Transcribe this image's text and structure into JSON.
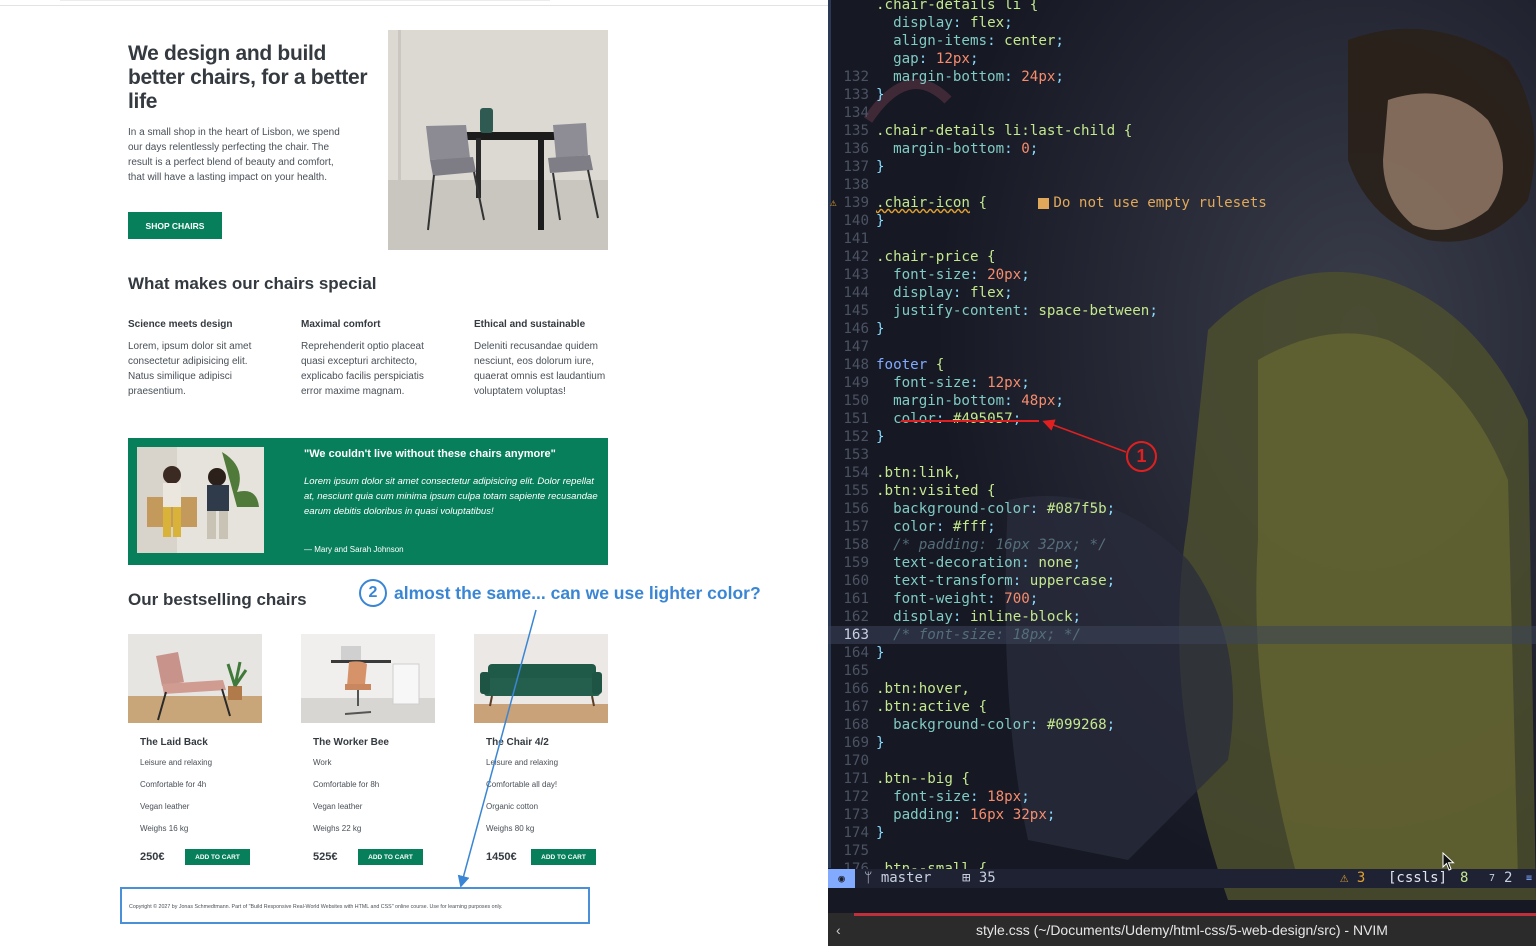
{
  "page": {
    "hero": {
      "title": "We design and build better chairs, for a better life",
      "text": "In a small shop in the heart of Lisbon, we spend our days relentlessly perfecting the chair. The result is a perfect blend of beauty and comfort, that will have a lasting impact on your health.",
      "button": "SHOP CHAIRS"
    },
    "features": {
      "heading": "What makes our chairs special",
      "items": [
        {
          "title": "Science meets design",
          "text": "Lorem, ipsum dolor sit amet consectetur adipisicing elit. Natus similique adipisci praesentium."
        },
        {
          "title": "Maximal comfort",
          "text": "Reprehenderit optio placeat quasi excepturi architecto, explicabo facilis perspiciatis error maxime magnam."
        },
        {
          "title": "Ethical and sustainable",
          "text": "Deleniti recusandae quidem nesciunt, eos dolorum iure, quaerat omnis est laudantium voluptatem voluptas!"
        }
      ]
    },
    "testimonial": {
      "quote": "\"We couldn't live without these chairs anymore\"",
      "text": "Lorem ipsum dolor sit amet consectetur adipisicing elit. Dolor repellat at, nesciunt quia cum minima ipsum culpa totam sapiente recusandae earum debitis doloribus in quasi voluptatibus!",
      "author": "— Mary and Sarah Johnson"
    },
    "products": {
      "heading": "Our bestselling chairs",
      "items": [
        {
          "name": "The Laid Back",
          "details": [
            "Leisure and relaxing",
            "Comfortable for 4h",
            "Vegan leather",
            "Weighs 16 kg"
          ],
          "price": "250€",
          "button": "ADD TO CART"
        },
        {
          "name": "The Worker Bee",
          "details": [
            "Work",
            "Comfortable for 8h",
            "Vegan leather",
            "Weighs 22 kg"
          ],
          "price": "525€",
          "button": "ADD TO CART"
        },
        {
          "name": "The Chair 4/2",
          "details": [
            "Leisure and relaxing",
            "Comfortable all day!",
            "Organic cotton",
            "Weighs 80 kg"
          ],
          "price": "1450€",
          "button": "ADD TO CART"
        }
      ]
    },
    "footer": "Copyright © 2027 by Jonas Schmedtmann. Part of \"Build Responsive Real-World Websites with HTML and CSS\" online course. Use for learning purposes only."
  },
  "annotations": {
    "one": "1",
    "two": "2",
    "two_text": "almost the same... can we use lighter color?",
    "red": "#e02020",
    "blue": "#3a86d4"
  },
  "editor": {
    "lines": [
      {
        "n": "",
        "html": "<span class='sel'>.chair-details li {</span>"
      },
      {
        "n": "",
        "html": "  <span class='prop'>display</span><span class='punc'>:</span> <span class='kw'>flex</span><span class='punc'>;</span>"
      },
      {
        "n": "",
        "html": "  <span class='prop'>align-items</span><span class='punc'>:</span> <span class='kw'>center</span><span class='punc'>;</span>"
      },
      {
        "n": "",
        "html": "  <span class='prop'>gap</span><span class='punc'>:</span> <span class='num'>12px</span><span class='punc'>;</span>"
      },
      {
        "n": "132",
        "html": "  <span class='prop'>margin-bottom</span><span class='punc'>:</span> <span class='num'>24px</span><span class='punc'>;</span>"
      },
      {
        "n": "133",
        "html": "<span class='punc'>}</span>"
      },
      {
        "n": "134",
        "html": ""
      },
      {
        "n": "135",
        "html": "<span class='sel'>.chair-details li:last-child {</span>"
      },
      {
        "n": "136",
        "html": "  <span class='prop'>margin-bottom</span><span class='punc'>:</span> <span class='num'>0</span><span class='punc'>;</span>"
      },
      {
        "n": "137",
        "html": "<span class='punc'>}</span>"
      },
      {
        "n": "138",
        "html": ""
      },
      {
        "n": "139",
        "warn": true,
        "html": "<span class='sel' style='text-decoration: underline wavy #e0a030;'>.chair-icon</span> <span class='sel'>{</span>      <span class='diag'><span class='diag-box'></span>Do not use empty rulesets</span>"
      },
      {
        "n": "140",
        "html": "<span class='punc'>}</span>"
      },
      {
        "n": "141",
        "html": ""
      },
      {
        "n": "142",
        "html": "<span class='sel'>.chair-price {</span>"
      },
      {
        "n": "143",
        "html": "  <span class='prop'>font-size</span><span class='punc'>:</span> <span class='num'>20px</span><span class='punc'>;</span>"
      },
      {
        "n": "144",
        "html": "  <span class='prop'>display</span><span class='punc'>:</span> <span class='kw'>flex</span><span class='punc'>;</span>"
      },
      {
        "n": "145",
        "html": "  <span class='prop'>justify-content</span><span class='punc'>:</span> <span class='kw'>space-between</span><span class='punc'>;</span>"
      },
      {
        "n": "146",
        "html": "<span class='punc'>}</span>"
      },
      {
        "n": "147",
        "html": ""
      },
      {
        "n": "148",
        "html": "<span style='color:#82aaff'>footer</span> <span class='sel'>{</span>"
      },
      {
        "n": "149",
        "html": "  <span class='prop'>font-size</span><span class='punc'>:</span> <span class='num'>12px</span><span class='punc'>;</span>"
      },
      {
        "n": "150",
        "html": "  <span class='prop'>margin-bottom</span><span class='punc'>:</span> <span class='num'>48px</span><span class='punc'>;</span>"
      },
      {
        "n": "151",
        "html": "  <span class='prop'>color</span><span class='punc'>:</span> <span class='hex'>#495057</span><span class='punc'>;</span>"
      },
      {
        "n": "152",
        "html": "<span class='punc'>}</span>"
      },
      {
        "n": "153",
        "html": ""
      },
      {
        "n": "154",
        "html": "<span class='sel'>.btn:link,</span>"
      },
      {
        "n": "155",
        "html": "<span class='sel'>.btn:visited {</span>"
      },
      {
        "n": "156",
        "html": "  <span class='prop'>background-color</span><span class='punc'>:</span> <span class='hex'>#087f5b</span><span class='punc'>;</span>"
      },
      {
        "n": "157",
        "html": "  <span class='prop'>color</span><span class='punc'>:</span> <span class='hex'>#fff</span><span class='punc'>;</span>"
      },
      {
        "n": "158",
        "html": "  <span class='cmt'>/* padding: 16px 32px; */</span>"
      },
      {
        "n": "159",
        "html": "  <span class='prop'>text-decoration</span><span class='punc'>:</span> <span class='kw'>none</span><span class='punc'>;</span>"
      },
      {
        "n": "160",
        "html": "  <span class='prop'>text-transform</span><span class='punc'>:</span> <span class='kw'>uppercase</span><span class='punc'>;</span>"
      },
      {
        "n": "161",
        "html": "  <span class='prop'>font-weight</span><span class='punc'>:</span> <span class='num'>700</span><span class='punc'>;</span>"
      },
      {
        "n": "162",
        "html": "  <span class='prop'>display</span><span class='punc'>:</span> <span class='kw'>inline-block</span><span class='punc'>;</span>"
      },
      {
        "n": "163",
        "cur": true,
        "html": "  <span class='cmt'>/* font-size: 18px; */</span>"
      },
      {
        "n": "164",
        "html": "<span class='punc'>}</span>"
      },
      {
        "n": "165",
        "html": ""
      },
      {
        "n": "166",
        "html": "<span class='sel'>.btn:hover,</span>"
      },
      {
        "n": "167",
        "html": "<span class='sel'>.btn:active {</span>"
      },
      {
        "n": "168",
        "html": "  <span class='prop'>background-color</span><span class='punc'>:</span> <span class='hex'>#099268</span><span class='punc'>;</span>"
      },
      {
        "n": "169",
        "html": "<span class='punc'>}</span>"
      },
      {
        "n": "170",
        "html": ""
      },
      {
        "n": "171",
        "html": "<span class='sel'>.btn--big {</span>"
      },
      {
        "n": "172",
        "html": "  <span class='prop'>font-size</span><span class='punc'>:</span> <span class='num'>18px</span><span class='punc'>;</span>"
      },
      {
        "n": "173",
        "html": "  <span class='prop'>padding</span><span class='punc'>:</span> <span class='num'>16px 32px</span><span class='punc'>;</span>"
      },
      {
        "n": "174",
        "html": "<span class='punc'>}</span>"
      },
      {
        "n": "175",
        "html": ""
      },
      {
        "n": "176",
        "html": "<span class='sel'>.btn--small {</span>"
      }
    ],
    "status": {
      "mode": "◉",
      "branch": "ᛘ master",
      "lines": "⊞ 35",
      "warnings": "⚠ 3",
      "lsp": "[cssls]",
      "extra": "8",
      "extra2": "7",
      "extra3": "2",
      "extra4": "≡"
    },
    "window_title": "style.css (~/Documents/Udemy/html-css/5-web-design/src) - NVIM",
    "back": "‹"
  }
}
